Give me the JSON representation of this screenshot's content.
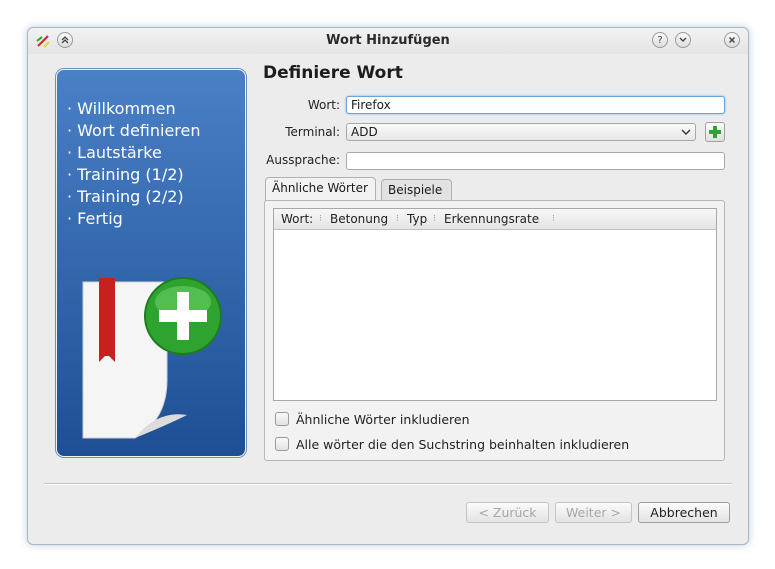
{
  "window": {
    "title": "Wort Hinzufügen"
  },
  "sidebar": {
    "steps": [
      "Willkommen",
      "Wort definieren",
      "Lautstärke",
      "Training (1/2)",
      "Training (2/2)",
      "Fertig"
    ]
  },
  "form": {
    "heading": "Definiere Wort",
    "word_label": "Wort:",
    "word_value": "Firefox",
    "terminal_label": "Terminal:",
    "terminal_value": "ADD",
    "pronunciation_label": "Aussprache:",
    "pronunciation_value": ""
  },
  "tabs": [
    {
      "label": "Ähnliche Wörter",
      "active": true
    },
    {
      "label": "Beispiele",
      "active": false
    }
  ],
  "table": {
    "columns": [
      "Wort:",
      "Betonung",
      "Typ",
      "Erkennungsrate"
    ],
    "rows": []
  },
  "checkboxes": [
    {
      "label": "Ähnliche Wörter inkludieren",
      "checked": false
    },
    {
      "label": "Alle wörter die den Suchstring beinhalten inkludieren",
      "checked": false
    }
  ],
  "buttons": {
    "back": "< Zurück",
    "next": "Weiter >",
    "cancel": "Abbrechen"
  },
  "colors": {
    "sidebar_top": "#4a80c6",
    "sidebar_bottom": "#1e4f94",
    "accent_green": "#2fa32f",
    "bookmark_red": "#c8201c"
  }
}
